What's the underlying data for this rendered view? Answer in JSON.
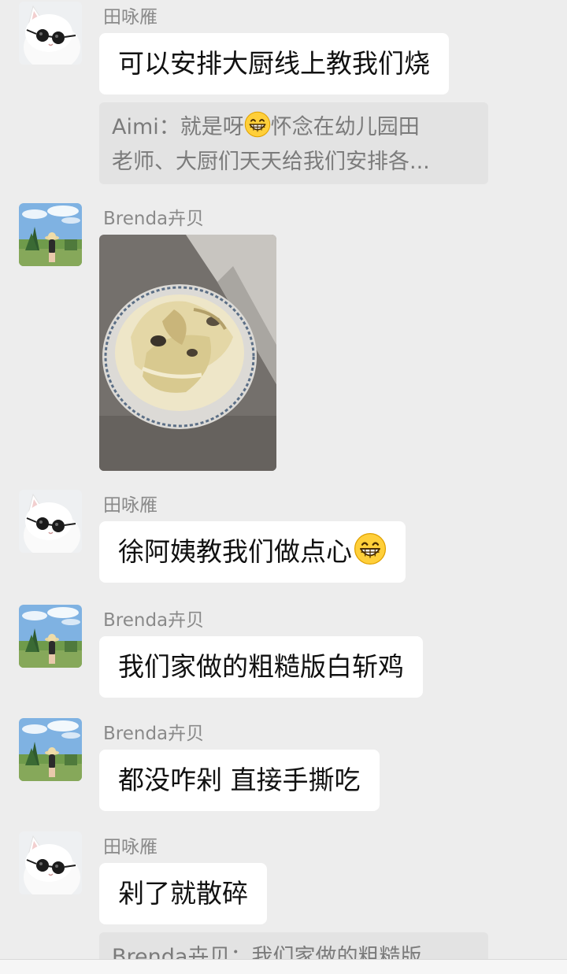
{
  "messages": [
    {
      "sender": "田咏雁",
      "text": "可以安排大厨线上教我们烧",
      "quote": {
        "line1": "Aimi：就是呀",
        "line1_after_emoji": "怀念在幼儿园田",
        "line2": "老师、大厨们天天给我们安排各..."
      }
    },
    {
      "sender": "Brenda卉贝",
      "image_alt": "plate of chicken photo"
    },
    {
      "sender": "田咏雁",
      "text": "徐阿姨教我们做点心"
    },
    {
      "sender": "Brenda卉贝",
      "text": "我们家做的粗糙版白斩鸡"
    },
    {
      "sender": "Brenda卉贝",
      "text": "都没咋剁 直接手撕吃"
    },
    {
      "sender": "田咏雁",
      "text": "剁了就散碎",
      "quote": {
        "line1": "Brenda卉贝：我们家做的粗糙版"
      }
    }
  ],
  "colors": {
    "background": "#ededed",
    "bubble": "#ffffff",
    "quote_bg": "#e3e3e3",
    "sender_text": "#8a8a8a"
  },
  "icons": {
    "grin": "grinning-face-emoji"
  }
}
